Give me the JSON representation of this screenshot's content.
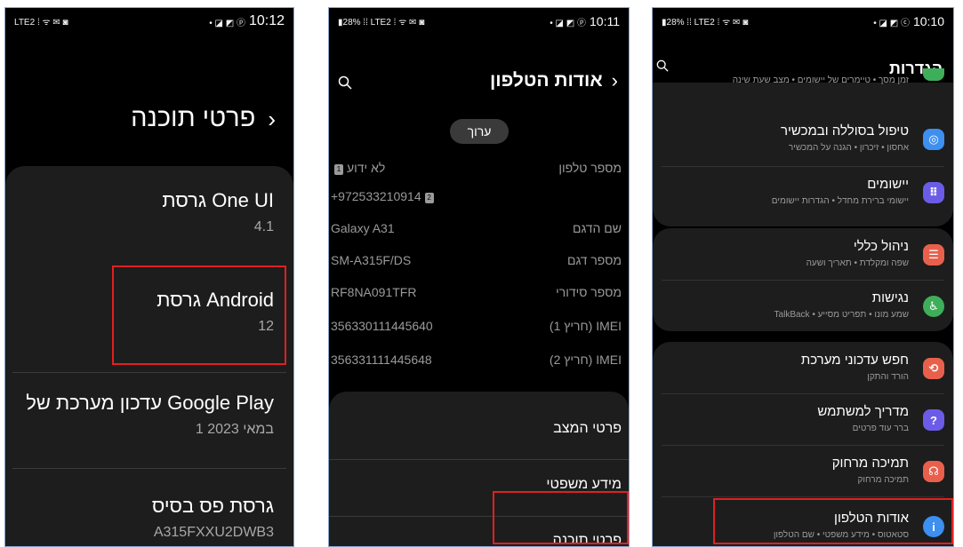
{
  "screens": {
    "software_info": {
      "status": {
        "left": "LTE2 ⁞ ᯤ ✉ ◙",
        "right": "• ◪ ◩ ⓟ",
        "time": "10:12"
      },
      "title": "פרטי תוכנה",
      "items": [
        {
          "label": "גרסת One UI",
          "value": "4.1"
        },
        {
          "label": "גרסת Android",
          "value": "12"
        },
        {
          "label": "עדכון מערכת של Google Play",
          "value": "1 במאי 2023"
        },
        {
          "label": "גרסת פס בסיס",
          "value": "A315FXXU2DWB3"
        }
      ]
    },
    "about_phone": {
      "status": {
        "left": "▮28% ⁞⁞ LTE2 ⁞ ᯤ ✉ ◙",
        "right": "• ◪ ◩ ⓟ",
        "time": "10:11"
      },
      "title": "אודות הטלפון",
      "edit_label": "ערוך",
      "rows": [
        {
          "label": "מספר טלפון",
          "value": "לא ידוע",
          "sim": "1"
        },
        {
          "label": "",
          "value": "+972533210914",
          "sim": "2"
        },
        {
          "label": "שם הדגם",
          "value": "Galaxy A31"
        },
        {
          "label": "מספר דגם",
          "value": "SM-A315F/DS"
        },
        {
          "label": "מספר סידורי",
          "value": "RF8NA091TFR"
        },
        {
          "label": "IMEI (חריץ 1)",
          "value": "356330111445640"
        },
        {
          "label": "IMEI (חריץ 2)",
          "value": "356331111445648"
        }
      ],
      "menu": [
        "פרטי המצב",
        "מידע משפטי",
        "פרטי תוכנה"
      ]
    },
    "settings": {
      "status": {
        "left": "▮28% ⁞⁞ LTE2 ⁞ ᯤ ✉ ◙",
        "right": "• ◪ ◩ ⓒ",
        "time": "10:10"
      },
      "title": "הגדרות",
      "items": [
        {
          "title": "",
          "subtitle": "זמן מסך • טיימרים של יישומים • מצב שעת שינה",
          "icon_color": "#3fae5a"
        },
        {
          "title": "טיפול בסוללה ובמכשיר",
          "subtitle": "אחסון • זיכרון • הגנה על המכשיר",
          "icon_color": "#3d8ff0",
          "icon": "◎"
        },
        {
          "title": "יישומים",
          "subtitle": "יישומי ברירת מחדל • הגדרות יישומים",
          "icon_color": "#6b5ce7",
          "icon": "⠿"
        },
        {
          "title": "ניהול כללי",
          "subtitle": "שפה ומקלדת • תאריך ושעה",
          "icon_color": "#e8604c",
          "icon": "☰"
        },
        {
          "title": "נגישות",
          "subtitle": "שמע מונו • תפריט מסייע • TalkBack",
          "icon_color": "#3fae5a",
          "icon": "♿"
        },
        {
          "title": "חפש עדכוני מערכת",
          "subtitle": "הורד והתקן",
          "icon_color": "#e8604c",
          "icon": "⟲"
        },
        {
          "title": "מדריך למשתמש",
          "subtitle": "ברר עוד פרטים",
          "icon_color": "#6b5ce7",
          "icon": "?"
        },
        {
          "title": "תמיכה מרחוק",
          "subtitle": "תמיכה מרחוק",
          "icon_color": "#e8604c",
          "icon": "☊"
        },
        {
          "title": "אודות הטלפון",
          "subtitle": "סטאטוס • מידע משפטי • שם הטלפון",
          "icon_color": "#3d8ff0",
          "icon": "i"
        }
      ]
    }
  },
  "colors": {
    "highlight": "#e02020",
    "background": "#000000",
    "card": "#1d1d1d"
  }
}
